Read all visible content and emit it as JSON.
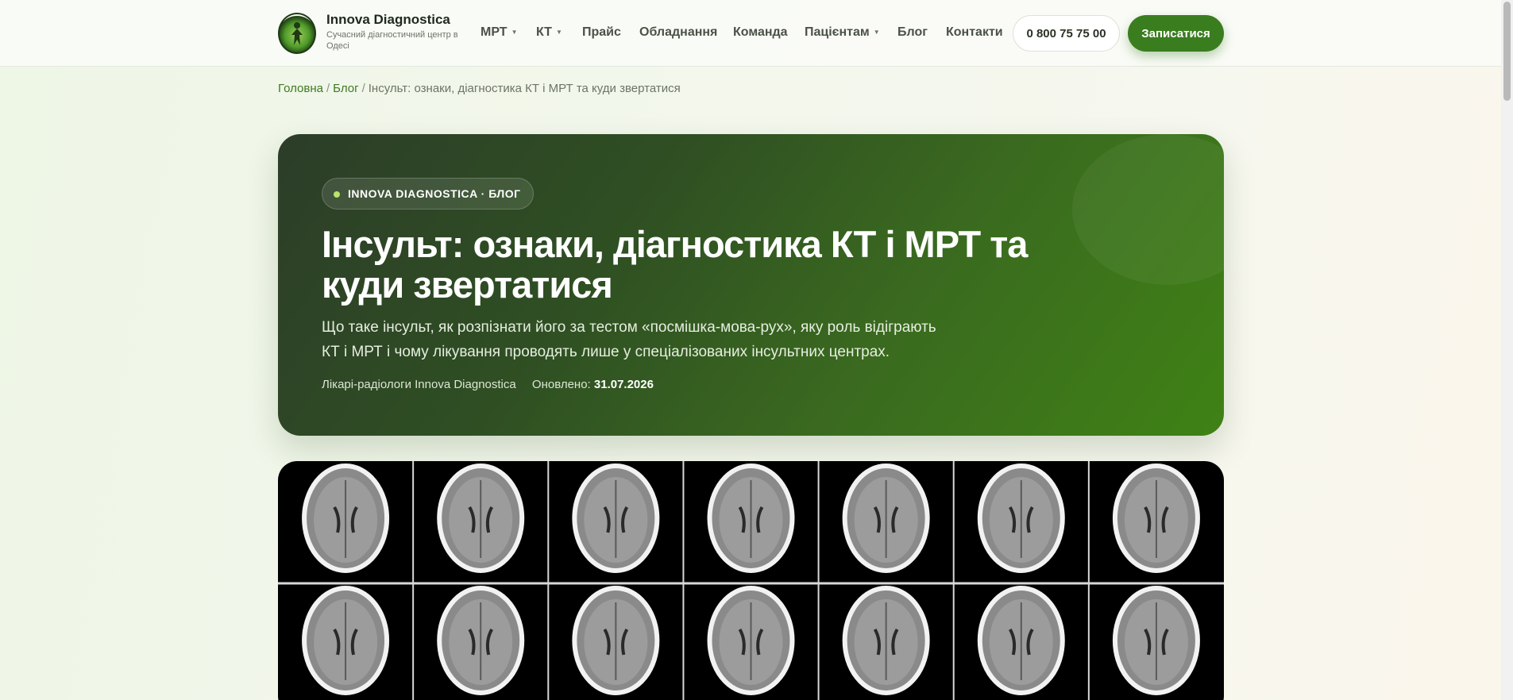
{
  "header": {
    "brand_name": "Innova Diagnostica",
    "brand_sub": "Сучасний діагностичний центр в Одесі",
    "nav": [
      {
        "label": "МРТ",
        "dropdown": true
      },
      {
        "label": "КТ",
        "dropdown": true
      },
      {
        "label": "Прайс",
        "dropdown": false
      },
      {
        "label": "Обладнання",
        "dropdown": false
      },
      {
        "label": "Команда",
        "dropdown": false
      },
      {
        "label": "Пацієнтам",
        "dropdown": true
      },
      {
        "label": "Блог",
        "dropdown": false
      },
      {
        "label": "Контакти",
        "dropdown": false
      }
    ],
    "phone": "0 800 75 75 00",
    "cta": "Записатися"
  },
  "breadcrumb": {
    "home": "Головна",
    "blog": "Блог",
    "current": "Інсульт: ознаки, діагностика КТ і МРТ та куди звертатися",
    "separator": "/"
  },
  "hero": {
    "badge": "INNOVA DIAGNOSTICA · БЛОГ",
    "title": "Інсульт: ознаки, діагностика КТ і МРТ та куди звертатися",
    "description": "Що таке інсульт, як розпізнати його за тестом «посмішка-мова-рух», яку роль відіграють КТ і МРТ і чому лікування проводять лише у спеціалізованих інсультних центрах.",
    "author": "Лікарі-радіологи Innova Diagnostica",
    "updated_label": "Оновлено:",
    "updated_date": "31.07.2026"
  },
  "icons": {
    "logo": "clinic-logo-icon",
    "caret": "chevron-down-icon"
  },
  "colors": {
    "accent": "#3a7d1f",
    "hero_start": "#2c3d28",
    "hero_end": "#3f8215",
    "badge_dot": "#b9e36b"
  }
}
